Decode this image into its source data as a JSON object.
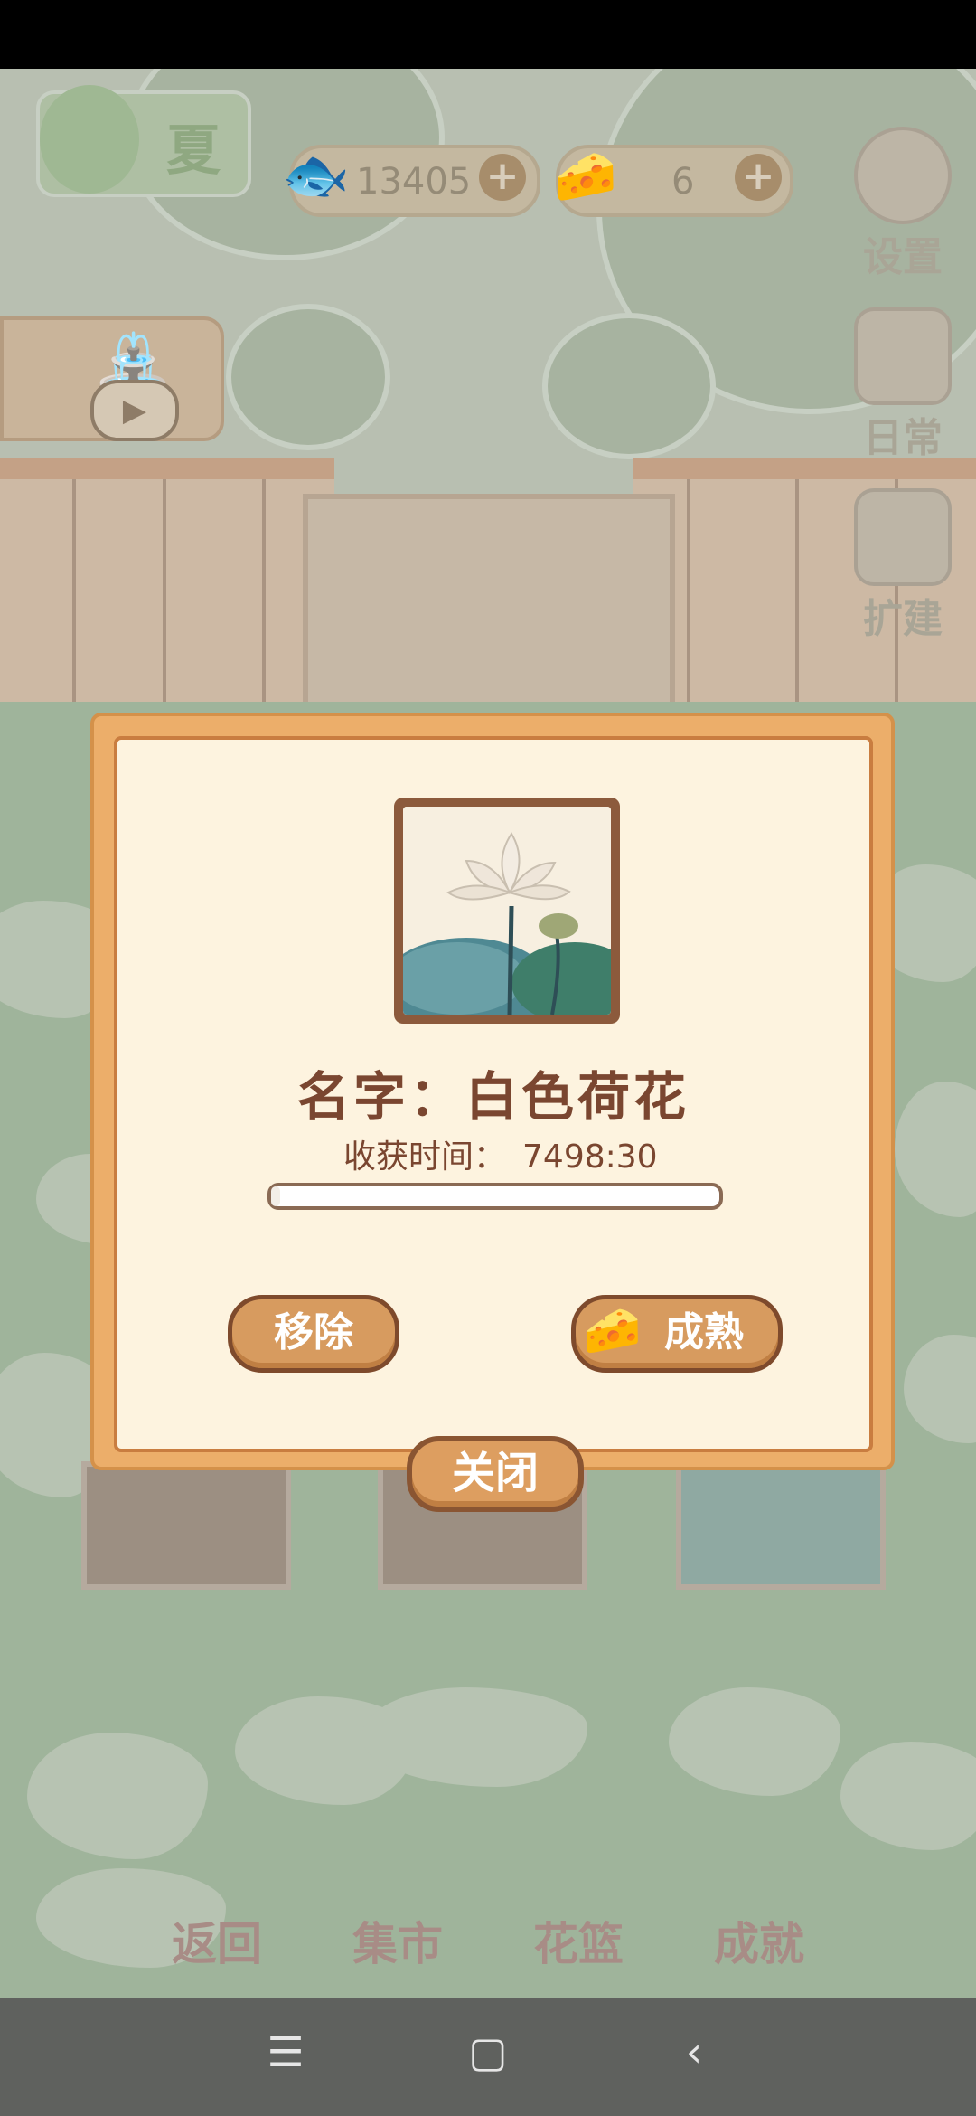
{
  "hud": {
    "season": "夏",
    "fish_count": "13405",
    "cheese_count": "6",
    "settings_label": "设置",
    "daily_label": "日常",
    "expand_label": "扩建"
  },
  "dialog": {
    "name_text": "名字：白色荷花",
    "harvest_label": "收获时间：",
    "harvest_value": "7498:30",
    "harvest_progress": 0.02,
    "remove_label": "移除",
    "ripen_label": "成熟",
    "close_label": "关闭"
  },
  "bottom_nav": {
    "back": "返回",
    "market": "集市",
    "basket": "花篮",
    "achievements": "成就"
  },
  "icons": [
    "fish-icon",
    "cheese-icon",
    "plus-icon",
    "gear-icon",
    "daily-note-icon",
    "hammer-icon",
    "watering-can-icon",
    "play-icon",
    "lotus-image",
    "menu-icon",
    "home-icon",
    "back-icon"
  ]
}
